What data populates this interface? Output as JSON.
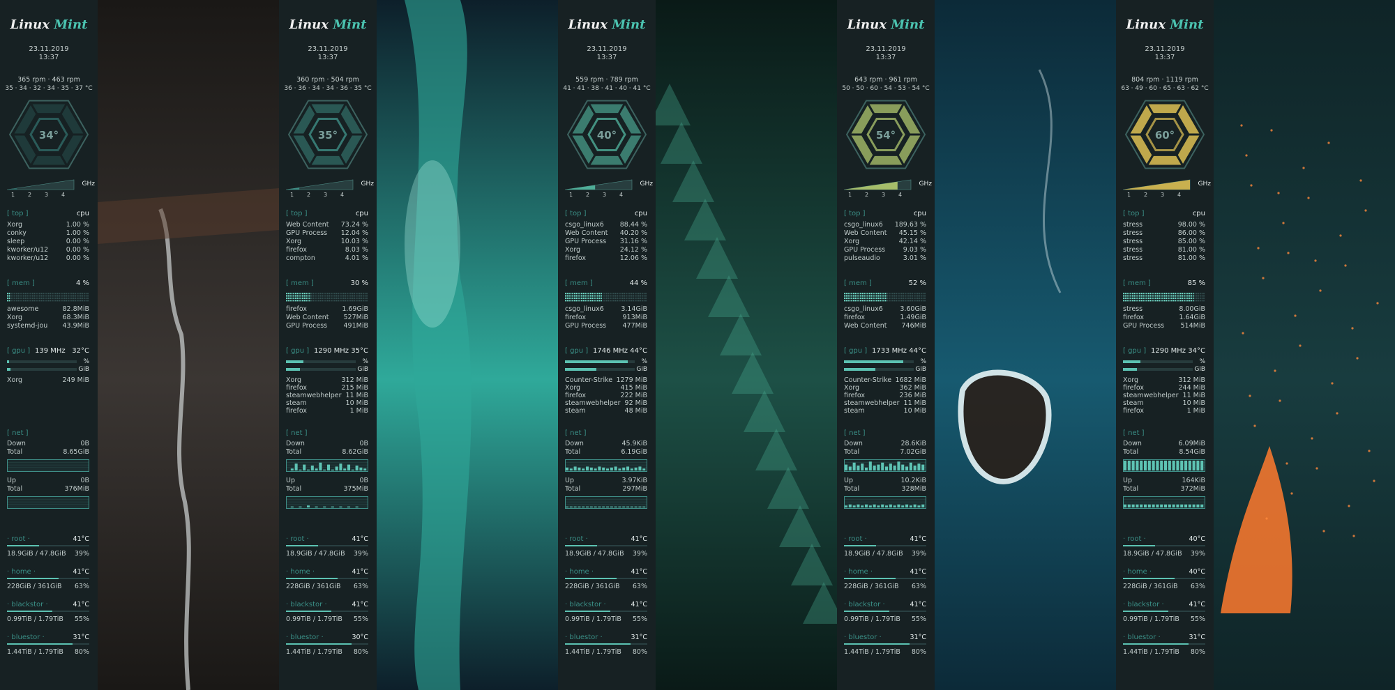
{
  "columns": [
    {
      "logo": {
        "word1": "Linux",
        "word2": "Mint"
      },
      "date": "23.11.2019",
      "time": "13:37",
      "rpm": "365 rpm  ·  463 rpm",
      "temps": "35 · 34 · 32 · 34 · 35 · 37 °C",
      "hex_temp": "34°",
      "hex_color": "#2f6a66",
      "hex_level": 0,
      "cpu_level": 0.15,
      "top": {
        "header": "[ top ]",
        "col": "cpu",
        "rows": [
          {
            "name": "Xorg",
            "value": "1.00 %"
          },
          {
            "name": "conky",
            "value": "1.00 %"
          },
          {
            "name": "sleep",
            "value": "0.00 %"
          },
          {
            "name": "kworker/u12",
            "value": "0.00 %"
          },
          {
            "name": "kworker/u12",
            "value": "0.00 %"
          }
        ]
      },
      "mem": {
        "header": "[ mem ]",
        "pct": "4 %",
        "level": 0.04,
        "rows": [
          {
            "name": "awesome",
            "value": "82.8MiB"
          },
          {
            "name": "Xorg",
            "value": "68.3MiB"
          },
          {
            "name": "systemd-jou",
            "value": "43.9MiB"
          }
        ]
      },
      "gpu": {
        "header": "[ gpu ]",
        "freq": "139 MHz",
        "temp": "32°C",
        "pct_label": "%",
        "gib_label": "GiB",
        "load": 0.03,
        "vram": 0.05,
        "rows": [
          {
            "name": "Xorg",
            "value": "249 MiB"
          }
        ]
      },
      "net": {
        "header": "[ net ]",
        "down_label": "Down",
        "down": "0B",
        "total_label": "Total",
        "down_total": "8.65GiB",
        "up_label": "Up",
        "up": "0B",
        "up_total": "376MiB",
        "down_graph": [
          0,
          0,
          0,
          0,
          0,
          0,
          0,
          0,
          0,
          0,
          0,
          0,
          0,
          0,
          0,
          0,
          0,
          0,
          0,
          0
        ],
        "up_graph": [
          0,
          0,
          0,
          0,
          0,
          0,
          0,
          0,
          0,
          0,
          0,
          0,
          0,
          0,
          0,
          0,
          0,
          0,
          0,
          0
        ]
      },
      "disks": [
        {
          "name": "· root ·",
          "temp": "41°C",
          "usage": "18.9GiB / 47.8GiB",
          "pct": "39%",
          "level": 0.39
        },
        {
          "name": "· home ·",
          "temp": "41°C",
          "usage": "228GiB / 361GiB",
          "pct": "63%",
          "level": 0.63
        },
        {
          "name": "· blackstor ·",
          "temp": "41°C",
          "usage": "0.99TiB / 1.79TiB",
          "pct": "55%",
          "level": 0.55
        },
        {
          "name": "· bluestor ·",
          "temp": "31°C",
          "usage": "1.44TiB / 1.79TiB",
          "pct": "80%",
          "level": 0.8
        }
      ]
    },
    {
      "logo": {
        "word1": "Linux",
        "word2": "Mint"
      },
      "date": "23.11.2019",
      "time": "13:37",
      "rpm": "360 rpm  ·  504 rpm",
      "temps": "36 · 36 · 34 · 34 · 36 · 35 °C",
      "hex_temp": "35°",
      "hex_color": "#3e8f86",
      "hex_level": 1,
      "cpu_level": 0.2,
      "top": {
        "header": "[ top ]",
        "col": "cpu",
        "rows": [
          {
            "name": "Web Content",
            "value": "73.24 %"
          },
          {
            "name": "GPU Process",
            "value": "12.04 %"
          },
          {
            "name": "Xorg",
            "value": "10.03 %"
          },
          {
            "name": "firefox",
            "value": "8.03 %"
          },
          {
            "name": "compton",
            "value": "4.01 %"
          }
        ]
      },
      "mem": {
        "header": "[ mem ]",
        "pct": "30 %",
        "level": 0.3,
        "rows": [
          {
            "name": "firefox",
            "value": "1.69GiB"
          },
          {
            "name": "Web Content",
            "value": "527MiB"
          },
          {
            "name": "GPU Process",
            "value": "491MiB"
          }
        ]
      },
      "gpu": {
        "header": "[ gpu ]",
        "freq": "1290 MHz",
        "temp": "35°C",
        "pct_label": "%",
        "gib_label": "GiB",
        "load": 0.25,
        "vram": 0.2,
        "rows": [
          {
            "name": "Xorg",
            "value": "312 MiB"
          },
          {
            "name": "firefox",
            "value": "215 MiB"
          },
          {
            "name": "steamwebhelper",
            "value": "11 MiB"
          },
          {
            "name": "steam",
            "value": "10 MiB"
          },
          {
            "name": "firefox",
            "value": "1 MiB"
          }
        ]
      },
      "net": {
        "header": "[ net ]",
        "down_label": "Down",
        "down": "0B",
        "total_label": "Total",
        "down_total": "8.62GiB",
        "up_label": "Up",
        "up": "0B",
        "up_total": "375MiB",
        "down_graph": [
          0,
          0.2,
          0.7,
          0.1,
          0.6,
          0.1,
          0.5,
          0.2,
          0.8,
          0.1,
          0.6,
          0.1,
          0.4,
          0.7,
          0.2,
          0.6,
          0.1,
          0.5,
          0.3,
          0.2
        ],
        "up_graph": [
          0,
          0.1,
          0,
          0.1,
          0,
          0.2,
          0,
          0.1,
          0,
          0.1,
          0,
          0.1,
          0,
          0.1,
          0,
          0.1,
          0,
          0.1,
          0,
          0
        ]
      },
      "disks": [
        {
          "name": "· root ·",
          "temp": "41°C",
          "usage": "18.9GiB / 47.8GiB",
          "pct": "39%",
          "level": 0.39
        },
        {
          "name": "· home ·",
          "temp": "41°C",
          "usage": "228GiB / 361GiB",
          "pct": "63%",
          "level": 0.63
        },
        {
          "name": "· blackstor ·",
          "temp": "41°C",
          "usage": "0.99TiB / 1.79TiB",
          "pct": "55%",
          "level": 0.55
        },
        {
          "name": "· bluestor ·",
          "temp": "30°C",
          "usage": "1.44TiB / 1.79TiB",
          "pct": "80%",
          "level": 0.8
        }
      ]
    },
    {
      "logo": {
        "word1": "Linux",
        "word2": "Mint"
      },
      "date": "23.11.2019",
      "time": "13:37",
      "rpm": "559 rpm  ·  789 rpm",
      "temps": "41 · 41 · 38 · 41 · 40 · 41 °C",
      "hex_temp": "40°",
      "hex_color": "#4fae98",
      "hex_level": 2,
      "cpu_level": 0.45,
      "top": {
        "header": "[ top ]",
        "col": "cpu",
        "rows": [
          {
            "name": "csgo_linux6",
            "value": "88.44 %"
          },
          {
            "name": "Web Content",
            "value": "40.20 %"
          },
          {
            "name": "GPU Process",
            "value": "31.16 %"
          },
          {
            "name": "Xorg",
            "value": "24.12 %"
          },
          {
            "name": "firefox",
            "value": "12.06 %"
          }
        ]
      },
      "mem": {
        "header": "[ mem ]",
        "pct": "44 %",
        "level": 0.44,
        "rows": [
          {
            "name": "csgo_linux6",
            "value": "3.14GiB"
          },
          {
            "name": "firefox",
            "value": "913MiB"
          },
          {
            "name": "GPU Process",
            "value": "477MiB"
          }
        ]
      },
      "gpu": {
        "header": "[ gpu ]",
        "freq": "1746 MHz",
        "temp": "44°C",
        "pct_label": "%",
        "gib_label": "GiB",
        "load": 0.9,
        "vram": 0.45,
        "rows": [
          {
            "name": "Counter-Strike",
            "value": "1279 MiB"
          },
          {
            "name": "Xorg",
            "value": "415 MiB"
          },
          {
            "name": "firefox",
            "value": "222 MiB"
          },
          {
            "name": "steamwebhelper",
            "value": "92 MiB"
          },
          {
            "name": "steam",
            "value": "48 MiB"
          }
        ]
      },
      "net": {
        "header": "[ net ]",
        "down_label": "Down",
        "down": "45.9KiB",
        "total_label": "Total",
        "down_total": "6.19GiB",
        "up_label": "Up",
        "up": "3.97KiB",
        "up_total": "297MiB",
        "down_graph": [
          0.3,
          0.2,
          0.4,
          0.3,
          0.2,
          0.4,
          0.3,
          0.2,
          0.4,
          0.3,
          0.2,
          0.3,
          0.4,
          0.2,
          0.3,
          0.4,
          0.2,
          0.3,
          0.4,
          0.2
        ],
        "up_graph": [
          0.1,
          0.1,
          0.1,
          0.1,
          0.1,
          0.1,
          0.1,
          0.1,
          0.1,
          0.1,
          0.1,
          0.1,
          0.1,
          0.1,
          0.1,
          0.1,
          0.1,
          0.1,
          0.1,
          0.1
        ]
      },
      "disks": [
        {
          "name": "· root ·",
          "temp": "41°C",
          "usage": "18.9GiB / 47.8GiB",
          "pct": "39%",
          "level": 0.39
        },
        {
          "name": "· home ·",
          "temp": "41°C",
          "usage": "228GiB / 361GiB",
          "pct": "63%",
          "level": 0.63
        },
        {
          "name": "· blackstor ·",
          "temp": "41°C",
          "usage": "0.99TiB / 1.79TiB",
          "pct": "55%",
          "level": 0.55
        },
        {
          "name": "· bluestor ·",
          "temp": "31°C",
          "usage": "1.44TiB / 1.79TiB",
          "pct": "80%",
          "level": 0.8
        }
      ]
    },
    {
      "logo": {
        "word1": "Linux",
        "word2": "Mint"
      },
      "date": "23.11.2019",
      "time": "13:37",
      "rpm": "643 rpm  ·  961 rpm",
      "temps": "50 · 50 · 60 · 54 · 53 · 54 °C",
      "hex_temp": "54°",
      "hex_color": "#a6bd6a",
      "hex_level": 3,
      "cpu_level": 0.8,
      "top": {
        "header": "[ top ]",
        "col": "cpu",
        "rows": [
          {
            "name": "csgo_linux6",
            "value": "189.63 %"
          },
          {
            "name": "Web Content",
            "value": "45.15 %"
          },
          {
            "name": "Xorg",
            "value": "42.14 %"
          },
          {
            "name": "GPU Process",
            "value": "9.03 %"
          },
          {
            "name": "pulseaudio",
            "value": "3.01 %"
          }
        ]
      },
      "mem": {
        "header": "[ mem ]",
        "pct": "52 %",
        "level": 0.52,
        "rows": [
          {
            "name": "csgo_linux6",
            "value": "3.60GiB"
          },
          {
            "name": "firefox",
            "value": "1.49GiB"
          },
          {
            "name": "Web Content",
            "value": "746MiB"
          }
        ]
      },
      "gpu": {
        "header": "[ gpu ]",
        "freq": "1733 MHz",
        "temp": "44°C",
        "pct_label": "%",
        "gib_label": "GiB",
        "load": 0.85,
        "vram": 0.45,
        "rows": [
          {
            "name": "Counter-Strike",
            "value": "1682 MiB"
          },
          {
            "name": "Xorg",
            "value": "362 MiB"
          },
          {
            "name": "firefox",
            "value": "236 MiB"
          },
          {
            "name": "steamwebhelper",
            "value": "11 MiB"
          },
          {
            "name": "steam",
            "value": "10 MiB"
          }
        ]
      },
      "net": {
        "header": "[ net ]",
        "down_label": "Down",
        "down": "28.6KiB",
        "total_label": "Total",
        "down_total": "7.02GiB",
        "up_label": "Up",
        "up": "10.2KiB",
        "up_total": "328MiB",
        "down_graph": [
          0.6,
          0.4,
          0.8,
          0.5,
          0.7,
          0.3,
          0.9,
          0.5,
          0.6,
          0.8,
          0.4,
          0.7,
          0.5,
          0.9,
          0.6,
          0.4,
          0.8,
          0.5,
          0.7,
          0.6
        ],
        "up_graph": [
          0.2,
          0.3,
          0.2,
          0.3,
          0.2,
          0.3,
          0.2,
          0.3,
          0.2,
          0.3,
          0.2,
          0.3,
          0.2,
          0.3,
          0.2,
          0.3,
          0.2,
          0.3,
          0.2,
          0.3
        ]
      },
      "disks": [
        {
          "name": "· root ·",
          "temp": "41°C",
          "usage": "18.9GiB / 47.8GiB",
          "pct": "39%",
          "level": 0.39
        },
        {
          "name": "· home ·",
          "temp": "41°C",
          "usage": "228GiB / 361GiB",
          "pct": "63%",
          "level": 0.63
        },
        {
          "name": "· blackstor ·",
          "temp": "41°C",
          "usage": "0.99TiB / 1.79TiB",
          "pct": "55%",
          "level": 0.55
        },
        {
          "name": "· bluestor ·",
          "temp": "31°C",
          "usage": "1.44TiB / 1.79TiB",
          "pct": "80%",
          "level": 0.8
        }
      ]
    },
    {
      "logo": {
        "word1": "Linux",
        "word2": "Mint"
      },
      "date": "23.11.2019",
      "time": "13:37",
      "rpm": "804 rpm  ·  1119 rpm",
      "temps": "63 · 49 · 60 · 65 · 63 · 62 °C",
      "hex_temp": "60°",
      "hex_color": "#c9b04f",
      "hex_level": 4,
      "cpu_level": 1.0,
      "top": {
        "header": "[ top ]",
        "col": "cpu",
        "rows": [
          {
            "name": "stress",
            "value": "98.00 %"
          },
          {
            "name": "stress",
            "value": "86.00 %"
          },
          {
            "name": "stress",
            "value": "85.00 %"
          },
          {
            "name": "stress",
            "value": "81.00 %"
          },
          {
            "name": "stress",
            "value": "81.00 %"
          }
        ]
      },
      "mem": {
        "header": "[ mem ]",
        "pct": "85 %",
        "level": 0.85,
        "rows": [
          {
            "name": "stress",
            "value": "8.00GiB"
          },
          {
            "name": "firefox",
            "value": "1.64GiB"
          },
          {
            "name": "GPU Process",
            "value": "514MiB"
          }
        ]
      },
      "gpu": {
        "header": "[ gpu ]",
        "freq": "1290 MHz",
        "temp": "34°C",
        "pct_label": "%",
        "gib_label": "GiB",
        "load": 0.25,
        "vram": 0.2,
        "rows": [
          {
            "name": "Xorg",
            "value": "312 MiB"
          },
          {
            "name": "firefox",
            "value": "244 MiB"
          },
          {
            "name": "steamwebhelper",
            "value": "11 MiB"
          },
          {
            "name": "steam",
            "value": "10 MiB"
          },
          {
            "name": "firefox",
            "value": "1 MiB"
          }
        ]
      },
      "net": {
        "header": "[ net ]",
        "down_label": "Down",
        "down": "6.09MiB",
        "total_label": "Total",
        "down_total": "8.54GiB",
        "up_label": "Up",
        "up": "164KiB",
        "up_total": "372MiB",
        "down_graph": [
          1,
          1,
          1,
          1,
          1,
          1,
          1,
          1,
          1,
          1,
          1,
          1,
          1,
          1,
          1,
          1,
          1,
          1,
          1,
          1
        ],
        "up_graph": [
          0.3,
          0.3,
          0.3,
          0.3,
          0.3,
          0.3,
          0.3,
          0.3,
          0.3,
          0.3,
          0.3,
          0.3,
          0.3,
          0.3,
          0.3,
          0.3,
          0.3,
          0.3,
          0.3,
          0.3
        ]
      },
      "disks": [
        {
          "name": "· root ·",
          "temp": "40°C",
          "usage": "18.9GiB / 47.8GiB",
          "pct": "39%",
          "level": 0.39
        },
        {
          "name": "· home ·",
          "temp": "40°C",
          "usage": "228GiB / 361GiB",
          "pct": "63%",
          "level": 0.63
        },
        {
          "name": "· blackstor ·",
          "temp": "41°C",
          "usage": "0.99TiB / 1.79TiB",
          "pct": "55%",
          "level": 0.55
        },
        {
          "name": "· bluestor ·",
          "temp": "31°C",
          "usage": "1.44TiB / 1.79TiB",
          "pct": "80%",
          "level": 0.8
        }
      ]
    }
  ],
  "wallpapers": [
    {
      "name": "waterfall-wallpaper",
      "colors": [
        "#1a1816",
        "#3b3633",
        "#cfd3d3"
      ]
    },
    {
      "name": "aurora-wallpaper",
      "colors": [
        "#0d1f2a",
        "#2fa99a",
        "#a8e8dc"
      ]
    },
    {
      "name": "forest-wallpaper",
      "colors": [
        "#0a1a17",
        "#1d5046",
        "#47a88f"
      ]
    },
    {
      "name": "ocean-rock-wallpaper",
      "colors": [
        "#0c2a38",
        "#175a70",
        "#e6f3f5"
      ]
    },
    {
      "name": "fire-wallpaper",
      "colors": [
        "#0f2427",
        "#183c3f",
        "#ff7a2e"
      ]
    }
  ]
}
